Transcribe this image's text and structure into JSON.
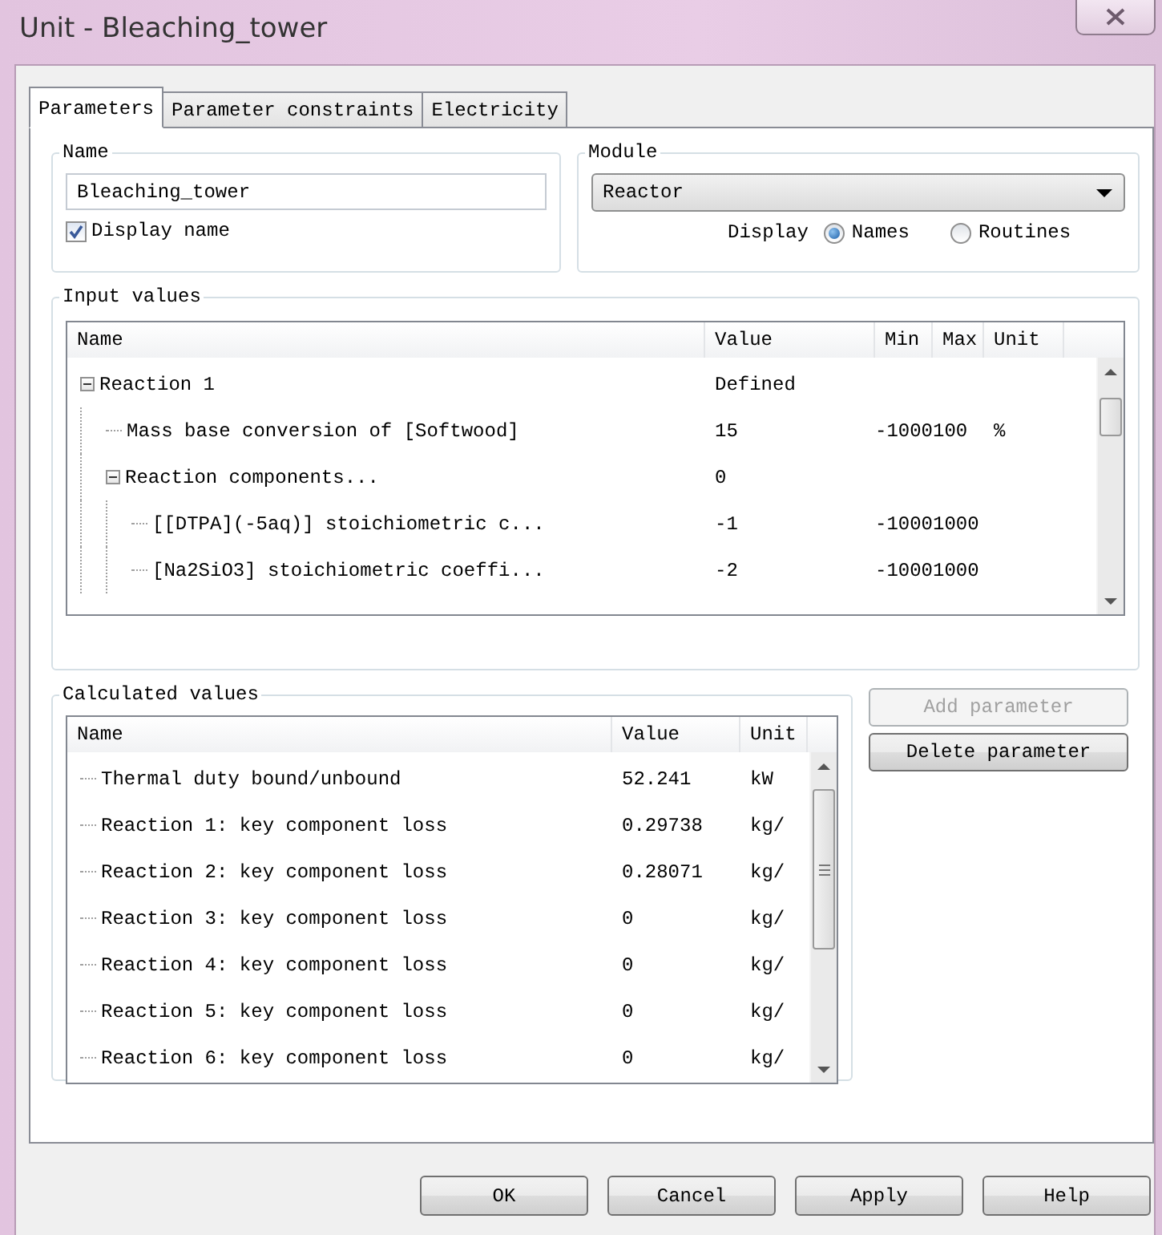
{
  "window": {
    "title": "Unit - Bleaching_tower"
  },
  "tabs": [
    {
      "label": "Parameters",
      "selected": true
    },
    {
      "label": "Parameter constraints",
      "selected": false
    },
    {
      "label": "Electricity",
      "selected": false
    }
  ],
  "name_group": {
    "title": "Name",
    "value": "Bleaching_tower",
    "display_name": {
      "label": "Display name",
      "checked": true
    }
  },
  "module_group": {
    "title": "Module",
    "module": "Reactor",
    "display_label": "Display",
    "display_options": [
      {
        "label": "Names",
        "selected": true
      },
      {
        "label": "Routines",
        "selected": false
      }
    ]
  },
  "input_values": {
    "title": "Input values",
    "columns": [
      "Name",
      "Value",
      "Min",
      "Max",
      "Unit"
    ],
    "rows": [
      {
        "name": "Reaction 1",
        "value": "Defined",
        "expanded": true,
        "children": [
          {
            "name": "Mass base conversion of [Softwood]",
            "value": "15",
            "min": "-1000",
            "max": "100",
            "unit": "%"
          },
          {
            "name": "Reaction components...",
            "value": "0",
            "expanded": true,
            "children": [
              {
                "name": "[[DTPA](-5aq)] stoichiometric c...",
                "value": "-1",
                "min": "-1000",
                "max": "1000"
              },
              {
                "name": "[Na2SiO3] stoichiometric coeffi...",
                "value": "-2",
                "min": "-1000",
                "max": "1000"
              }
            ]
          }
        ]
      }
    ]
  },
  "calculated_values": {
    "title": "Calculated values",
    "columns": [
      "Name",
      "Value",
      "Unit"
    ],
    "rows": [
      {
        "name": "Thermal duty bound/unbound",
        "value": "52.241",
        "unit": "kW"
      },
      {
        "name": "Reaction 1: key component loss",
        "value": "0.29738",
        "unit": "kg/"
      },
      {
        "name": "Reaction 2: key component loss",
        "value": "0.28071",
        "unit": "kg/"
      },
      {
        "name": "Reaction 3: key component loss",
        "value": "0",
        "unit": "kg/"
      },
      {
        "name": "Reaction 4: key component loss",
        "value": "0",
        "unit": "kg/"
      },
      {
        "name": "Reaction 5: key component loss",
        "value": "0",
        "unit": "kg/"
      },
      {
        "name": "Reaction 6: key component loss",
        "value": "0",
        "unit": "kg/"
      }
    ]
  },
  "side_buttons": [
    {
      "label": "Add parameter",
      "disabled": true
    },
    {
      "label": "Delete parameter",
      "disabled": false
    }
  ],
  "buttons": [
    "OK",
    "Cancel",
    "Apply",
    "Help"
  ]
}
